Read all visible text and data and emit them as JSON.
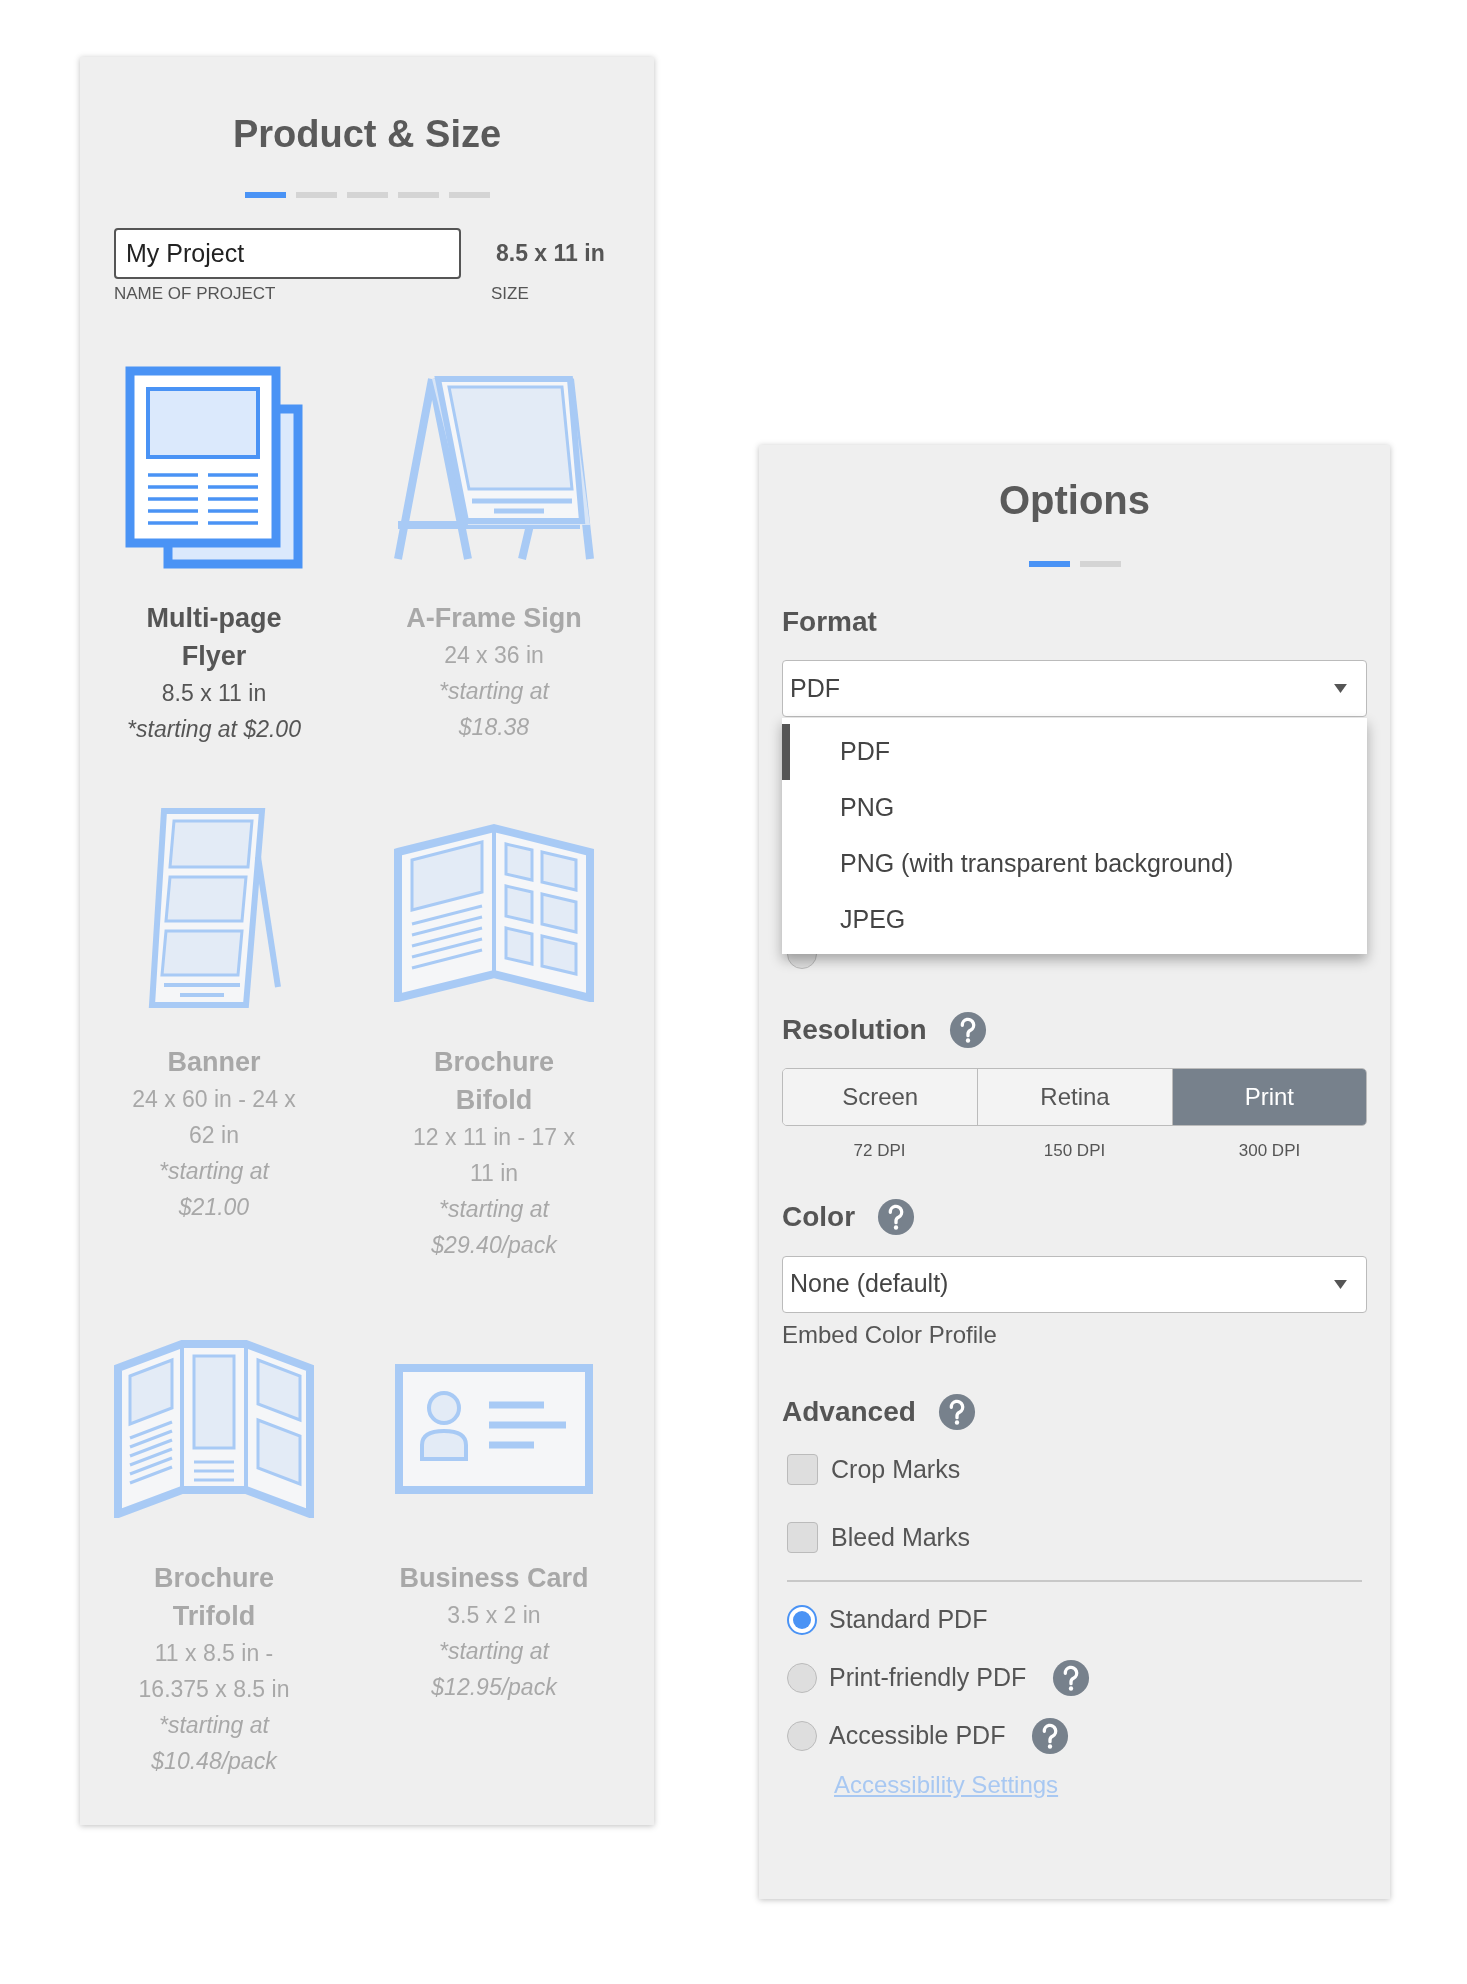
{
  "product_panel": {
    "title": "Product & Size",
    "steps": [
      {
        "selected": true
      },
      {
        "selected": false
      },
      {
        "selected": false
      },
      {
        "selected": false
      },
      {
        "selected": false
      }
    ],
    "project_name": {
      "value": "My Project",
      "label": "NAME OF PROJECT"
    },
    "size": {
      "value": "8.5 x 11 in",
      "label": "SIZE"
    },
    "products": [
      {
        "kind": "flyer",
        "name": "Multi-page Flyer",
        "size": "8.5 x 11 in",
        "price": "*starting at $2.00",
        "selected": true
      },
      {
        "kind": "aframe",
        "name": "A-Frame Sign",
        "size": "24 x 36 in",
        "price": "*starting at $18.38",
        "selected": false
      },
      {
        "kind": "banner",
        "name": "Banner",
        "size": "24 x 60 in - 24 x 62 in",
        "price": "*starting at $21.00",
        "selected": false
      },
      {
        "kind": "bifold",
        "name": "Brochure Bifold",
        "size": "12 x 11 in - 17 x 11 in",
        "price": "*starting at $29.40/pack",
        "selected": false
      },
      {
        "kind": "trifold",
        "name": "Brochure Trifold",
        "size": "11 x 8.5 in - 16.375 x 8.5 in",
        "price": "*starting at $10.48/pack",
        "selected": false
      },
      {
        "kind": "card",
        "name": "Business Card",
        "size": "3.5 x 2 in",
        "price": "*starting at $12.95/pack",
        "selected": false
      }
    ]
  },
  "options_panel": {
    "title": "Options",
    "steps": [
      {
        "selected": true
      },
      {
        "selected": false
      }
    ],
    "format": {
      "label": "Format",
      "value": "PDF",
      "options": [
        {
          "label": "PDF",
          "selected": true
        },
        {
          "label": "PNG",
          "selected": false
        },
        {
          "label": "PNG (with transparent background)",
          "selected": false
        },
        {
          "label": "JPEG",
          "selected": false
        }
      ]
    },
    "page_option": {
      "selected": false
    },
    "resolution": {
      "label": "Resolution",
      "options": [
        {
          "label": "Screen",
          "dpi": "72 DPI",
          "selected": false
        },
        {
          "label": "Retina",
          "dpi": "150 DPI",
          "selected": false
        },
        {
          "label": "Print",
          "dpi": "300 DPI",
          "selected": true
        }
      ]
    },
    "color": {
      "label": "Color",
      "value": "None (default)",
      "caption": "Embed Color Profile"
    },
    "advanced": {
      "label": "Advanced",
      "checkboxes": [
        {
          "label": "Crop Marks",
          "checked": false
        },
        {
          "label": "Bleed Marks",
          "checked": false
        }
      ],
      "pdf_types": [
        {
          "label": "Standard PDF",
          "selected": true,
          "help": false
        },
        {
          "label": "Print-friendly PDF",
          "selected": false,
          "help": true
        },
        {
          "label": "Accessible PDF",
          "selected": false,
          "help": true
        }
      ],
      "link": "Accessibility Settings"
    }
  }
}
